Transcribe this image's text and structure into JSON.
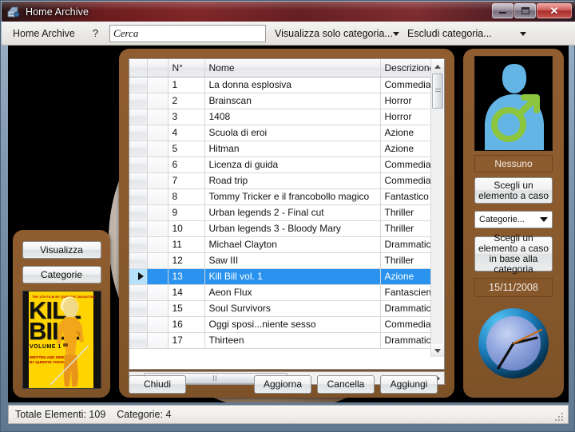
{
  "window": {
    "title": "Home Archive",
    "icon": "application-icon",
    "minimize_label": "–",
    "maximize_label": "□",
    "close_label": "✕"
  },
  "toolbar": {
    "menu_label": "Home Archive",
    "help_label": "?",
    "search_placeholder": "Cerca",
    "search_value": "",
    "filter_include": "Visualizza solo categoria...",
    "filter_exclude": "Escludi categoria..."
  },
  "left_panel": {
    "visualizza_label": "Visualizza",
    "categorie_label": "Categorie",
    "poster": {
      "top_credit": "THE 4TH FILM BY QUENTIN TARANTINO",
      "title_line1": "KILL",
      "title_line2": "BILL",
      "volume": "VOLUME 1",
      "bottom_credit": "WRITTEN AND DIRECTED\nBY QUENTIN TARANTINO"
    }
  },
  "grid": {
    "columns": [
      "N°",
      "Nome",
      "Descrizione"
    ],
    "selected_index": 12,
    "rows": [
      {
        "n": "1",
        "nome": "La donna esplosiva",
        "descrizione": "Commedia"
      },
      {
        "n": "2",
        "nome": "Brainscan",
        "descrizione": "Horror"
      },
      {
        "n": "3",
        "nome": "1408",
        "descrizione": "Horror"
      },
      {
        "n": "4",
        "nome": "Scuola di eroi",
        "descrizione": "Azione"
      },
      {
        "n": "5",
        "nome": "Hitman",
        "descrizione": "Azione"
      },
      {
        "n": "6",
        "nome": "Licenza di guida",
        "descrizione": "Commedia"
      },
      {
        "n": "7",
        "nome": "Road trip",
        "descrizione": "Commedia"
      },
      {
        "n": "8",
        "nome": "Tommy Tricker e il francobollo magico",
        "descrizione": "Fantastico"
      },
      {
        "n": "9",
        "nome": "Urban legends 2 - Final cut",
        "descrizione": "Thriller"
      },
      {
        "n": "10",
        "nome": "Urban legends 3 - Bloody Mary",
        "descrizione": "Thriller"
      },
      {
        "n": "11",
        "nome": "Michael Clayton",
        "descrizione": "Drammatico"
      },
      {
        "n": "12",
        "nome": "Saw III",
        "descrizione": "Thriller"
      },
      {
        "n": "13",
        "nome": "Kill Bill vol. 1",
        "descrizione": "Azione"
      },
      {
        "n": "14",
        "nome": "Aeon Flux",
        "descrizione": "Fantascienza"
      },
      {
        "n": "15",
        "nome": "Soul Survivors",
        "descrizione": "Drammatico"
      },
      {
        "n": "16",
        "nome": "Oggi sposi...niente sesso",
        "descrizione": "Commedia"
      },
      {
        "n": "17",
        "nome": "Thirteen",
        "descrizione": "Drammatico"
      }
    ]
  },
  "center_buttons": {
    "chiudi": "Chiudi",
    "aggiorna": "Aggiorna",
    "cancella": "Cancella",
    "aggiungi": "Aggiungi"
  },
  "right_panel": {
    "avatar_alt": "male-silhouette-avatar",
    "nessuno_label": "Nessuno",
    "random_label": "Scegli un elemento a caso",
    "categorie_placeholder": "Categorie...",
    "random_by_category_label": "Scegli un elemento a caso in base alla categoria",
    "date": "15/11/2008",
    "clock_time": "02:37"
  },
  "statusbar": {
    "total_label": "Totale Elementi:",
    "total_value": "109",
    "categories_label": "Categorie:",
    "categories_value": "4"
  },
  "colors": {
    "panel_brown": "#8a5a2d",
    "selection_blue": "#2a93f0",
    "avatar_blue": "#63b5e5",
    "avatar_green": "#8cc63f",
    "titlebar_red": "#8e2b2b"
  }
}
